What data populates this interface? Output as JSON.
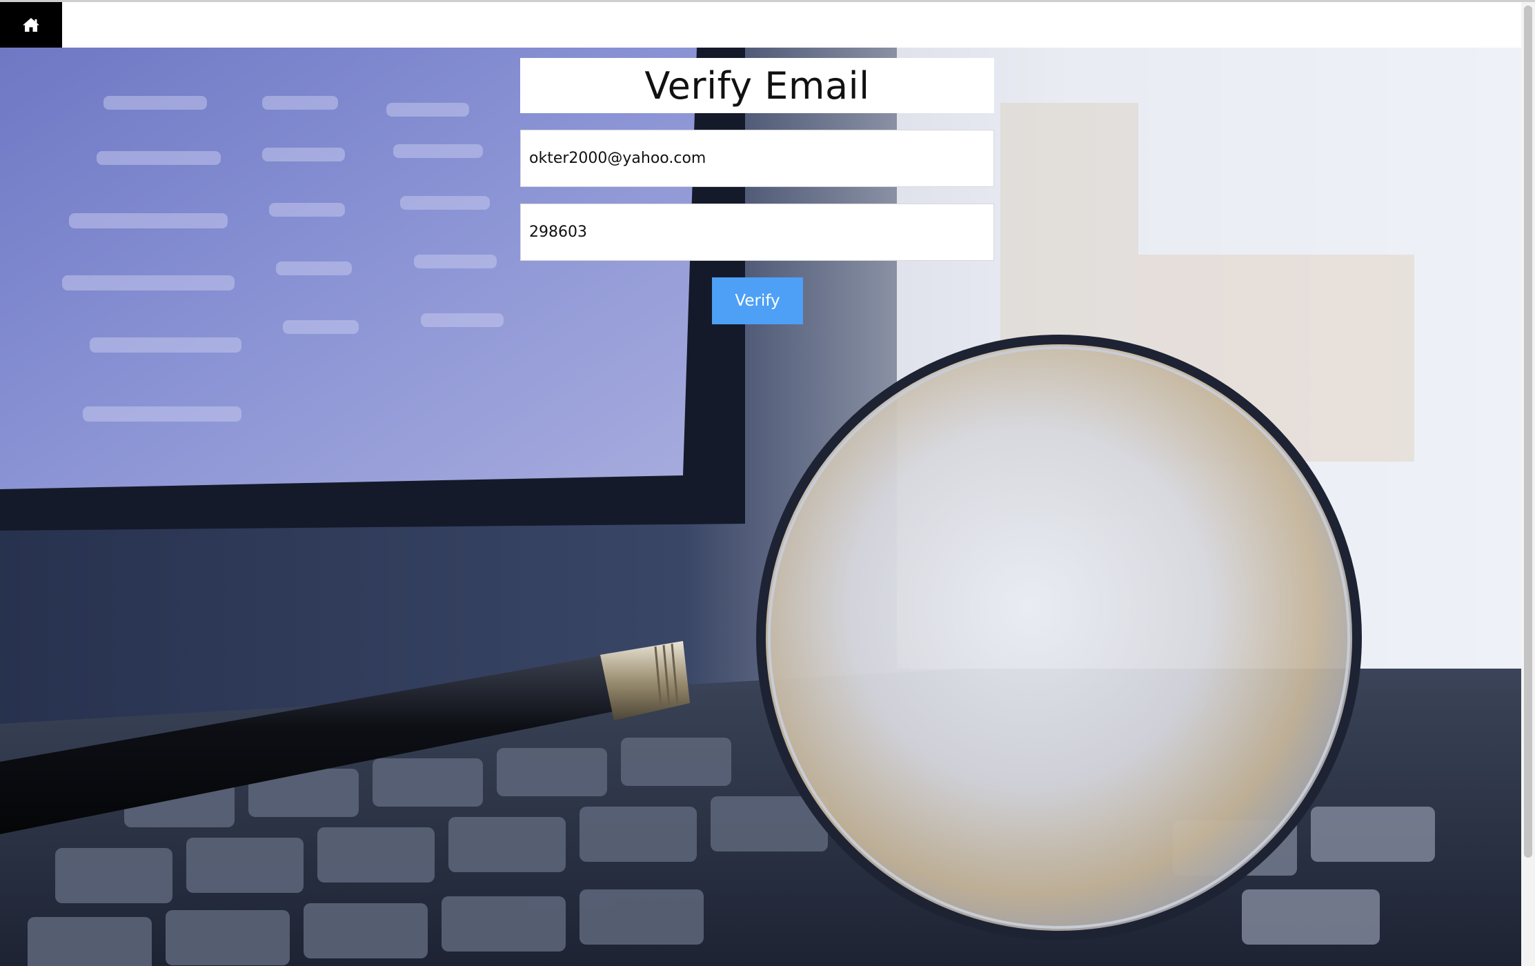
{
  "nav": {
    "home_icon": "home-icon"
  },
  "form": {
    "title": "Verify Email",
    "email_value": "okter2000@yahoo.com",
    "code_value": "298603",
    "submit_label": "Verify"
  },
  "colors": {
    "nav_background": "#ffffff",
    "home_button": "#000000",
    "accent_button": "#4da0f5"
  },
  "background_image": "laptop-with-magnifying-glass"
}
